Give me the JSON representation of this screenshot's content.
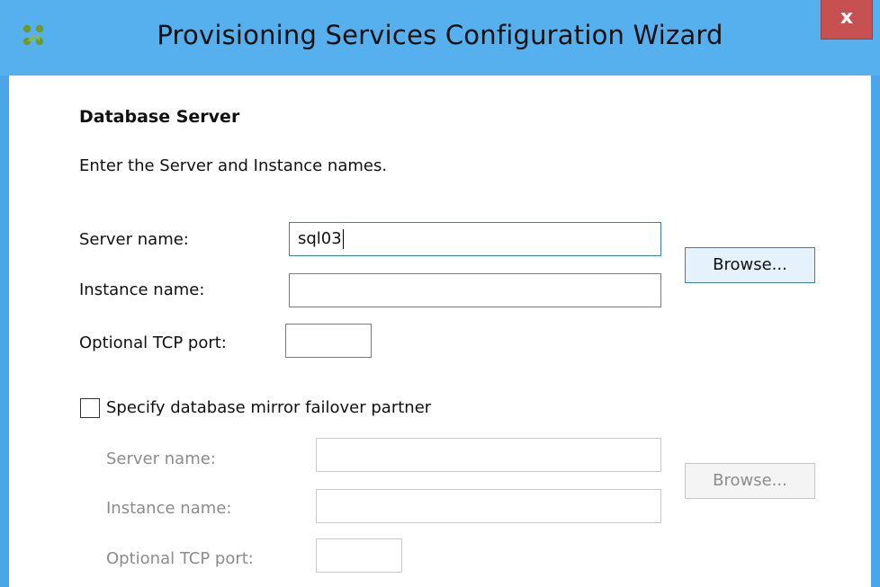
{
  "window": {
    "title": "Provisioning Services Configuration Wizard",
    "close_label": "x",
    "icon": "citrix-logo-icon"
  },
  "section": {
    "heading": "Database Server",
    "instruction": "Enter the Server and Instance names."
  },
  "primary": {
    "server_label": "Server name:",
    "server_value": "sql03",
    "instance_label": "Instance name:",
    "instance_value": "",
    "port_label": "Optional TCP port:",
    "port_value": "",
    "browse_label": "Browse..."
  },
  "mirror": {
    "checkbox_label": "Specify database mirror failover partner",
    "checked": false,
    "server_label": "Server name:",
    "server_value": "",
    "instance_label": "Instance name:",
    "instance_value": "",
    "port_label": "Optional TCP port:",
    "port_value": "",
    "browse_label": "Browse...",
    "enabled": false
  },
  "colors": {
    "titlebar": "#56b0ee",
    "close_button": "#c75050",
    "focus_border": "#3c7fb1",
    "disabled_text": "#8c8c8c"
  }
}
